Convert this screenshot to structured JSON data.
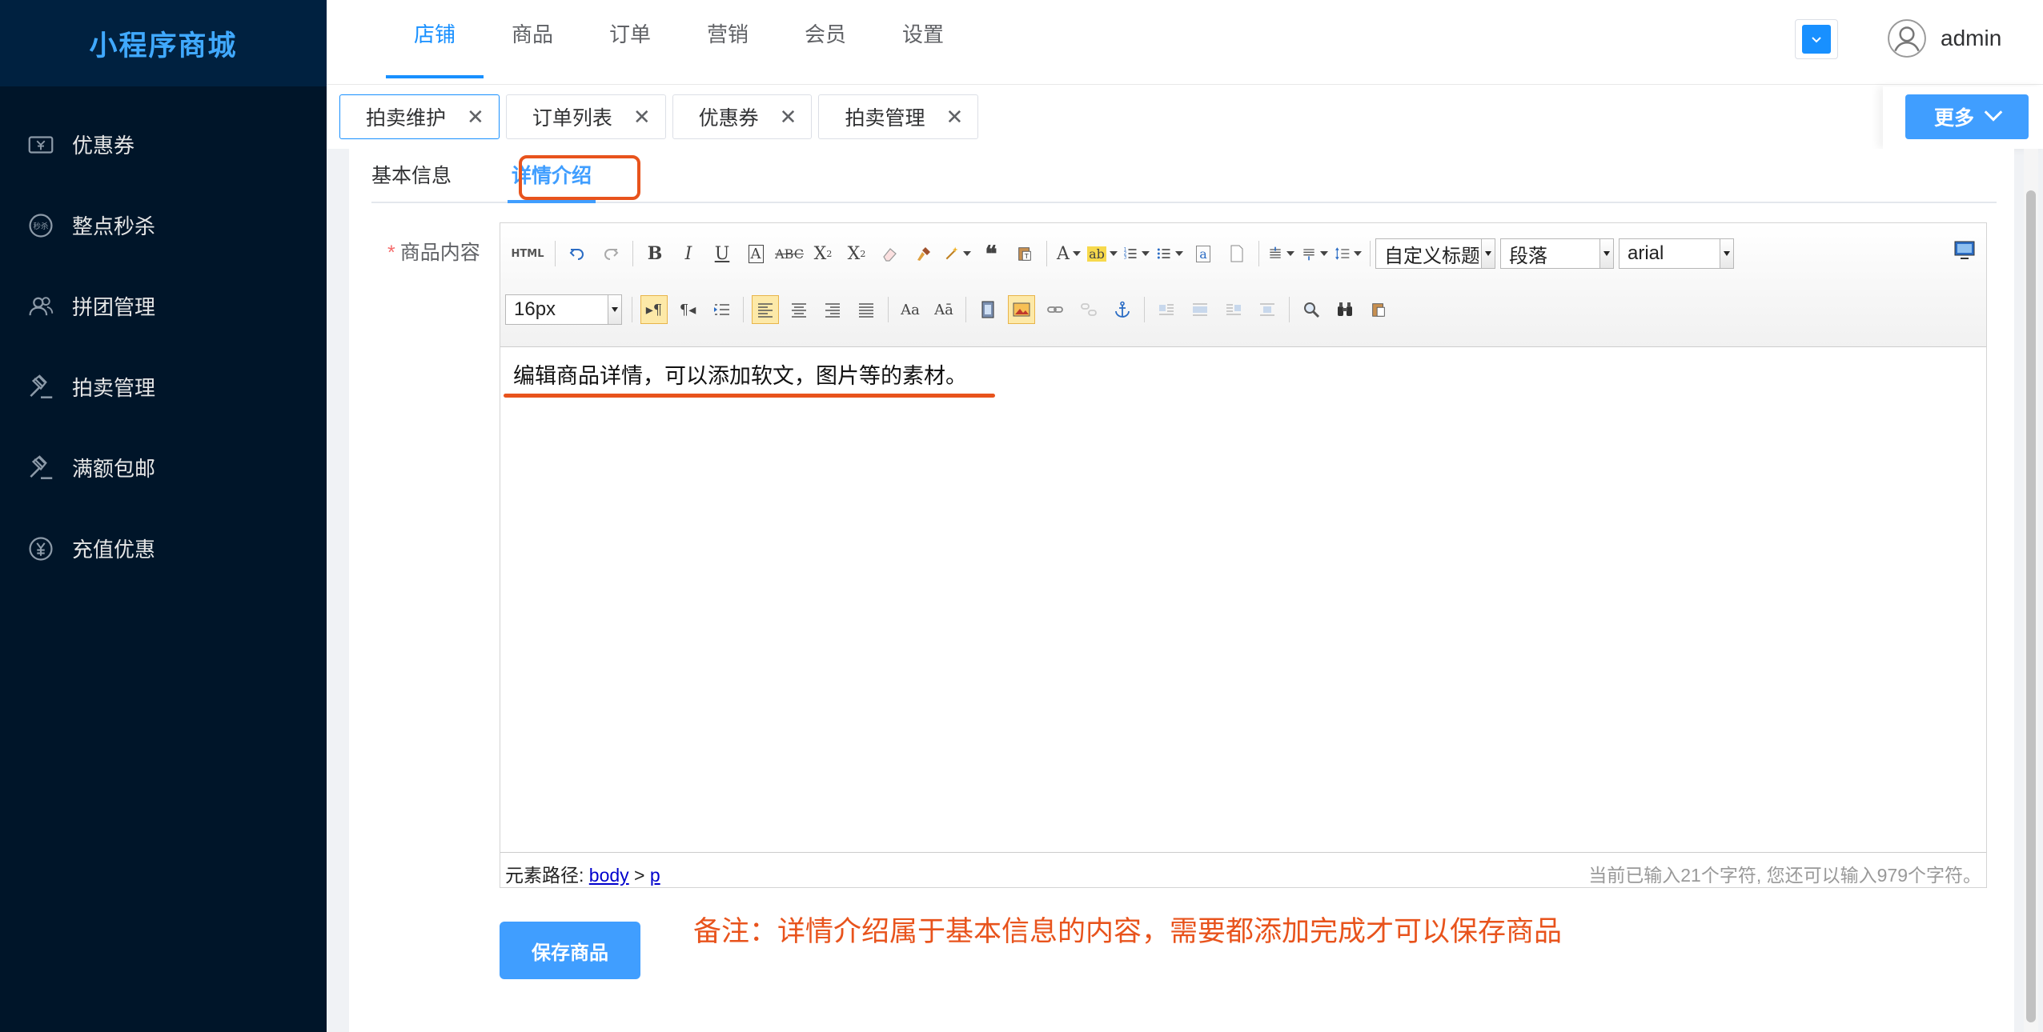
{
  "app": {
    "logo": "小程序商城"
  },
  "sidebar": {
    "items": [
      {
        "label": "优惠券",
        "icon": "ticket-icon"
      },
      {
        "label": "整点秒杀",
        "icon": "flash-sale-icon"
      },
      {
        "label": "拼团管理",
        "icon": "group-icon"
      },
      {
        "label": "拍卖管理",
        "icon": "gavel-icon"
      },
      {
        "label": "满额包邮",
        "icon": "gavel-icon"
      },
      {
        "label": "充值优惠",
        "icon": "yen-icon"
      }
    ]
  },
  "topnav": {
    "items": [
      "店铺",
      "商品",
      "订单",
      "营销",
      "会员",
      "设置"
    ],
    "active": "店铺"
  },
  "user": {
    "name": "admin"
  },
  "tabs": {
    "items": [
      "拍卖维护",
      "订单列表",
      "优惠券",
      "拍卖管理"
    ],
    "active": "拍卖维护",
    "more_label": "更多"
  },
  "form": {
    "tabs": [
      "基本信息",
      "详情介绍"
    ],
    "active_tab": "详情介绍",
    "field_label": "商品内容",
    "required_mark": "*"
  },
  "editor": {
    "font_size": "16px",
    "heading_select": "自定义标题",
    "paragraph_select": "段落",
    "font_family": "arial",
    "html_button": "HTML",
    "content": "编辑商品详情，可以添加软文，图片等的素材。",
    "path_label": "元素路径:",
    "path_body": "body",
    "path_sep": ">",
    "path_p": "p",
    "char_count": "当前已输入21个字符, 您还可以输入979个字符。"
  },
  "actions": {
    "save_label": "保存商品"
  },
  "note": "备注：详情介绍属于基本信息的内容，需要都添加完成才可以保存商品",
  "colors": {
    "sidebar_bg": "#001529",
    "accent": "#409eff",
    "annotation": "#e8531c"
  }
}
